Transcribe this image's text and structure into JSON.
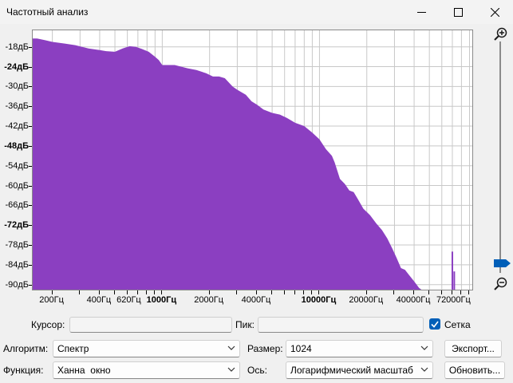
{
  "window": {
    "title": "Частотный анализ",
    "controls": [
      "minimize-icon",
      "maximize-icon",
      "close-icon"
    ]
  },
  "colors": {
    "spectrum_fill": "#8b3fc1",
    "grid": "#c8c8c8",
    "accent": "#005fb8"
  },
  "chart_data": {
    "type": "area",
    "x_scale": "log",
    "xlim": [
      150,
      96000
    ],
    "ylim": [
      -92,
      -13
    ],
    "grid": true,
    "xlabel": "",
    "ylabel": "",
    "y_tick_labels": [
      {
        "value": -18,
        "text": "-18дБ",
        "bold": false
      },
      {
        "value": -24,
        "text": "-24дБ",
        "bold": true
      },
      {
        "value": -30,
        "text": "-30дБ",
        "bold": false
      },
      {
        "value": -36,
        "text": "-36дБ",
        "bold": false
      },
      {
        "value": -42,
        "text": "-42дБ",
        "bold": false
      },
      {
        "value": -48,
        "text": "-48дБ",
        "bold": true
      },
      {
        "value": -54,
        "text": "-54дБ",
        "bold": false
      },
      {
        "value": -60,
        "text": "-60дБ",
        "bold": false
      },
      {
        "value": -66,
        "text": "-66дБ",
        "bold": false
      },
      {
        "value": -72,
        "text": "-72дБ",
        "bold": true
      },
      {
        "value": -78,
        "text": "-78дБ",
        "bold": false
      },
      {
        "value": -84,
        "text": "-84дБ",
        "bold": false
      },
      {
        "value": -90,
        "text": "-90дБ",
        "bold": false
      }
    ],
    "x_tick_labels": [
      {
        "value": 200,
        "text": "200Гц",
        "bold": false
      },
      {
        "value": 400,
        "text": "400Гц",
        "bold": false
      },
      {
        "value": 620,
        "text": "620Гц",
        "bold": false
      },
      {
        "value": 1000,
        "text": "1000Гц",
        "bold": true
      },
      {
        "value": 2000,
        "text": "2000Гц",
        "bold": false
      },
      {
        "value": 4000,
        "text": "4000Гц",
        "bold": false
      },
      {
        "value": 10000,
        "text": "10000Гц",
        "bold": true
      },
      {
        "value": 20000,
        "text": "20000Гц",
        "bold": false
      },
      {
        "value": 40000,
        "text": "40000Гц",
        "bold": false
      },
      {
        "value": 72000,
        "text": "72000Гц",
        "bold": false
      }
    ],
    "series": [
      {
        "x": [
          150,
          160,
          180,
          200,
          240,
          280,
          340,
          400,
          440,
          500,
          560,
          620,
          680,
          740,
          820,
          900,
          950,
          1000,
          1200,
          1450,
          1650,
          1900,
          2100,
          2300,
          2500,
          2800,
          3000,
          3400,
          3700,
          4000,
          4400,
          5000,
          5600,
          6200,
          7000,
          8000,
          9000,
          10000,
          11000,
          12000,
          12500,
          13500,
          14500,
          15500,
          16500,
          17500,
          19000,
          21000,
          23000,
          25000,
          27000,
          29000,
          31000,
          33000,
          35000,
          37000,
          40000,
          43000,
          46000,
          50000,
          53000
        ],
        "y": [
          -15.5,
          -15.5,
          -16,
          -16.5,
          -17,
          -17.5,
          -18.5,
          -19,
          -19.3,
          -19.5,
          -18.5,
          -17.8,
          -18,
          -18.6,
          -19.5,
          -21,
          -22,
          -23.5,
          -23.5,
          -24.5,
          -25,
          -26,
          -27,
          -27,
          -27.5,
          -30,
          -31,
          -32.5,
          -34.5,
          -35.5,
          -37,
          -38,
          -38.5,
          -39.5,
          -41,
          -42,
          -44,
          -46,
          -49,
          -51,
          -53,
          -58,
          -59.5,
          -61.5,
          -62,
          -64,
          -67,
          -69,
          -71.5,
          -73.5,
          -76,
          -79,
          -82,
          -85,
          -85.5,
          -87,
          -89,
          -91,
          -92,
          -92,
          -92
        ]
      }
    ],
    "spikes": [
      {
        "x": 70000,
        "y": -80
      },
      {
        "x": 72000,
        "y": -86
      }
    ]
  },
  "controls": {
    "cursor_label": "Курсор:",
    "cursor_value": "",
    "peak_label": "Пик:",
    "peak_value": "",
    "grid_label": "Сетка",
    "grid_checked": true,
    "algorithm_label": "Алгоритм:",
    "algorithm_value": "Спектр",
    "size_label": "Размер:",
    "size_value": "1024",
    "export_button": "Экспорт...",
    "function_label": "Функция:",
    "function_value": "Ханна  окно",
    "axis_label": "Ось:",
    "axis_value": "Логарифмический масштаб",
    "refresh_button": "Обновить..."
  }
}
